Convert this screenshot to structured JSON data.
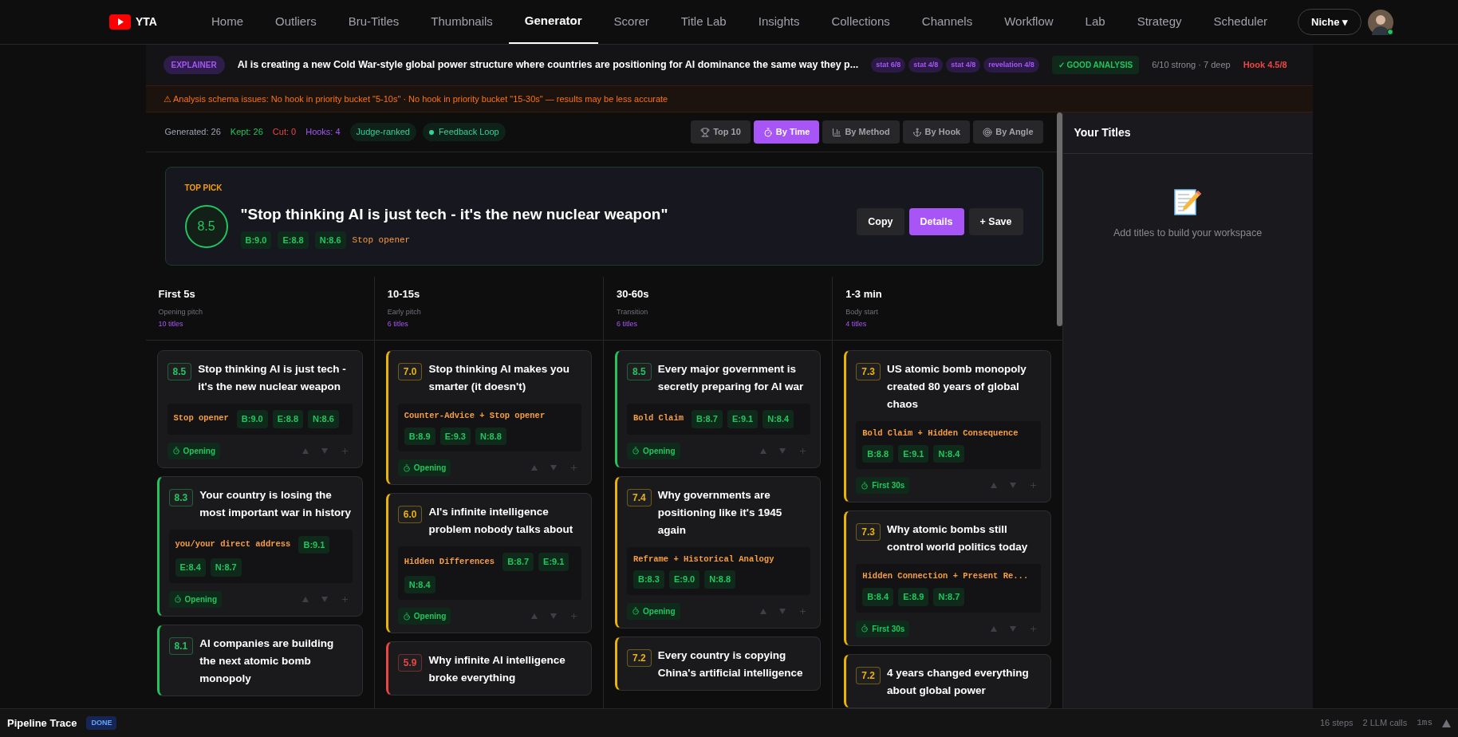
{
  "nav": {
    "logo": "YTA",
    "items": [
      {
        "label": "Home",
        "selected": false
      },
      {
        "label": "Outliers",
        "selected": false
      },
      {
        "label": "Bru-Titles",
        "selected": false
      },
      {
        "label": "Thumbnails",
        "selected": false
      },
      {
        "label": "Generator",
        "selected": true
      },
      {
        "label": "Scorer",
        "selected": false
      },
      {
        "label": "Title Lab",
        "selected": false
      },
      {
        "label": "Insights",
        "selected": false
      },
      {
        "label": "Collections",
        "selected": false
      },
      {
        "label": "Channels",
        "selected": false
      },
      {
        "label": "Workflow",
        "selected": false
      },
      {
        "label": "Lab",
        "selected": false
      },
      {
        "label": "Strategy",
        "selected": false
      },
      {
        "label": "Scheduler",
        "selected": false
      }
    ],
    "niche": "Niche ▾",
    "online": true
  },
  "analysis": {
    "type_badge": "EXPLAINER",
    "summary": "AI is creating a new Cold War-style global power structure where countries are positioning for AI dominance the same way they p...",
    "stats": [
      "stat 6/8",
      "stat 4/8",
      "stat 4/8",
      "revelation 4/8"
    ],
    "verdict": "✓ GOOD ANALYSIS",
    "depth": "6/10 strong · 7 deep",
    "hook_score": "Hook 4.5/8"
  },
  "warning": "⚠ Analysis schema issues: No hook in priority bucket \"5-10s\" · No hook in priority bucket \"15-30s\" — results may be less accurate",
  "counts": [
    {
      "label": "Generated: 26",
      "color": "#9ca3af"
    },
    {
      "label": "Kept: 26",
      "color": "#22c55e"
    },
    {
      "label": "Cut: 0",
      "color": "#ef4444"
    },
    {
      "label": "Hooks: 4",
      "color": "#a855f7"
    }
  ],
  "flags": [
    {
      "label": "Judge-ranked",
      "kind": "plain"
    },
    {
      "label": "Feedback Loop",
      "kind": "dot"
    }
  ],
  "views": [
    {
      "label": "Top 10",
      "selected": false
    },
    {
      "label": "By Time",
      "selected": true
    },
    {
      "label": "By Method",
      "selected": false
    },
    {
      "label": "By Hook",
      "selected": false
    },
    {
      "label": "By Angle",
      "selected": false
    }
  ],
  "top_pick": {
    "label": "TOP PICK",
    "score": "8.5",
    "title": "\"Stop thinking AI is just tech - it's the new nuclear weapon\"",
    "scores": [
      "B:9.0",
      "E:8.8",
      "N:8.6"
    ],
    "hook": "Stop opener",
    "buttons": [
      {
        "label": "Copy",
        "kind": "plain"
      },
      {
        "label": "Details",
        "kind": "primary"
      },
      {
        "label": "+ Save",
        "kind": "plain"
      }
    ]
  },
  "columns": [
    {
      "title": "First 5s",
      "subtitle": "Opening pitch",
      "count": "10 titles",
      "cards": [
        {
          "score": "8.5",
          "color": "#22c55e",
          "accent": false,
          "title": "Stop thinking AI is just tech - it's the new nuclear weapon",
          "hook": "Stop opener",
          "scores": [
            "B:9.0",
            "E:8.8",
            "N:8.6"
          ],
          "time": "Opening"
        },
        {
          "score": "8.3",
          "color": "#22c55e",
          "accent": true,
          "title": "Your country is losing the most important war in history",
          "hook": "you/your direct address",
          "scores": [
            "B:9.1",
            "E:8.4",
            "N:8.7"
          ],
          "time": "Opening"
        },
        {
          "score": "8.1",
          "color": "#22c55e",
          "accent": true,
          "title": "AI companies are building the next atomic bomb monopoly"
        }
      ]
    },
    {
      "title": "10-15s",
      "subtitle": "Early pitch",
      "count": "6 titles",
      "cards": [
        {
          "score": "7.0",
          "color": "#eab308",
          "accent": true,
          "title": "Stop thinking AI makes you smarter (it doesn't)",
          "hook": "Counter-Advice + Stop opener",
          "scores": [
            "B:8.9",
            "E:9.3",
            "N:8.8"
          ],
          "time": "Opening"
        },
        {
          "score": "6.0",
          "color": "#eab308",
          "accent": true,
          "title": "AI's infinite intelligence problem nobody talks about",
          "hook": "Hidden Differences",
          "scores": [
            "B:8.7",
            "E:9.1",
            "N:8.4"
          ],
          "time": "Opening"
        },
        {
          "score": "5.9",
          "color": "#ef4444",
          "accent": true,
          "title": "Why infinite AI intelligence broke everything"
        }
      ]
    },
    {
      "title": "30-60s",
      "subtitle": "Transition",
      "count": "6 titles",
      "cards": [
        {
          "score": "8.5",
          "color": "#22c55e",
          "accent": true,
          "title": "Every major government is secretly preparing for AI war",
          "hook": "Bold Claim",
          "scores": [
            "B:8.7",
            "E:9.1",
            "N:8.4"
          ],
          "time": "Opening"
        },
        {
          "score": "7.4",
          "color": "#eab308",
          "accent": true,
          "title": "Why governments are positioning like it's 1945 again",
          "hook": "Reframe + Historical Analogy",
          "scores": [
            "B:8.3",
            "E:9.0",
            "N:8.8"
          ],
          "time": "Opening"
        },
        {
          "score": "7.2",
          "color": "#eab308",
          "accent": true,
          "title": "Every country is copying China's artificial intelligence"
        }
      ]
    },
    {
      "title": "1-3 min",
      "subtitle": "Body start",
      "count": "4 titles",
      "cards": [
        {
          "score": "7.3",
          "color": "#eab308",
          "accent": true,
          "title": "US atomic bomb monopoly created 80 years of global chaos",
          "hook": "Bold Claim + Hidden Consequence",
          "scores": [
            "B:8.8",
            "E:9.1",
            "N:8.4"
          ],
          "time": "First 30s"
        },
        {
          "score": "7.3",
          "color": "#eab308",
          "accent": true,
          "title": "Why atomic bombs still control world politics today",
          "hook": "Hidden Connection + Present Re...",
          "scores": [
            "B:8.4",
            "E:8.9",
            "N:8.7"
          ],
          "time": "First 30s"
        },
        {
          "score": "7.2",
          "color": "#eab308",
          "accent": true,
          "title": "4 years changed everything about global power"
        }
      ]
    }
  ],
  "workspace": {
    "title": "Your Titles",
    "empty": "Add titles to build your workspace"
  },
  "status_bar": {
    "title": "Pipeline Trace",
    "state": "DONE",
    "steps": "16 steps",
    "calls": "2 LLM calls",
    "time": "1ms"
  }
}
